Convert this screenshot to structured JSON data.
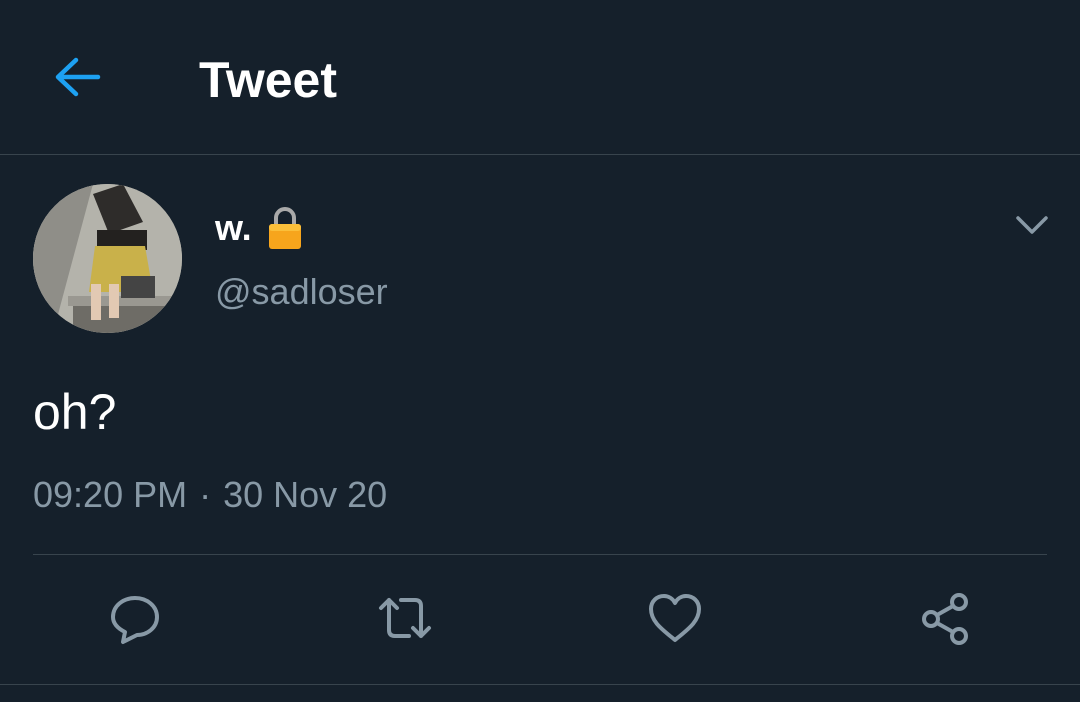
{
  "header": {
    "title": "Tweet",
    "back_icon": "arrow-left-icon",
    "accent_color": "#1da1f2"
  },
  "tweet": {
    "author": {
      "display_name": "w.",
      "handle": "@sadloser",
      "protected_icon": "lock-icon"
    },
    "text": "oh?",
    "time": "09:20 PM",
    "separator": "·",
    "date": "30 Nov 20"
  },
  "actions": [
    {
      "name": "reply",
      "icon": "reply-icon"
    },
    {
      "name": "retweet",
      "icon": "retweet-icon"
    },
    {
      "name": "like",
      "icon": "heart-icon"
    },
    {
      "name": "share",
      "icon": "share-icon"
    }
  ],
  "colors": {
    "background": "#15202b",
    "secondary_text": "#8899a6",
    "divider": "#38444d"
  }
}
